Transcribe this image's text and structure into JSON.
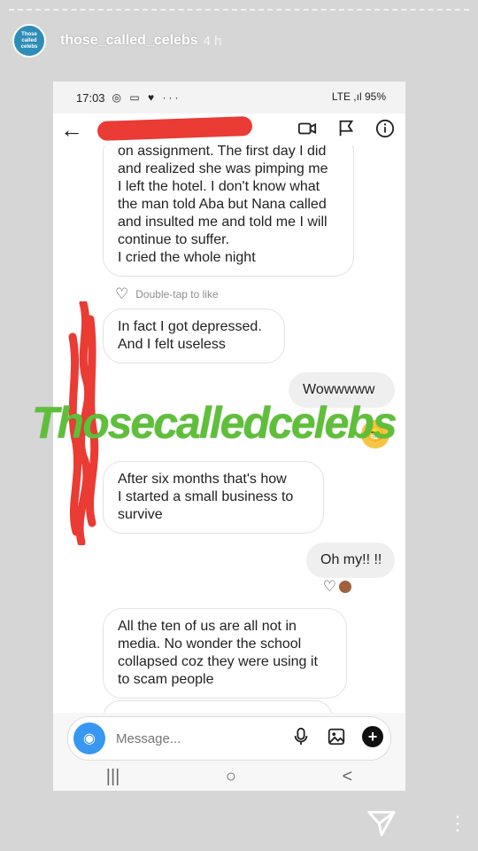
{
  "story": {
    "avatar_text": "Those called celebs",
    "username": "those_called_celebs",
    "time_ago": "4 h"
  },
  "status_bar": {
    "time": "17:03",
    "icons": "◎ ▭ ♥ ···",
    "right": "LTE ,ıl 95%"
  },
  "messages": {
    "m1": [
      "on assignment. The first day I did",
      "and realized she was pimping me",
      "I left the hotel. I don't know what",
      "the man told Aba but Nana called",
      "and insulted me and told me I will",
      "continue to suffer.",
      "I cried the whole night"
    ],
    "like_hint": "Double-tap to like",
    "m2": [
      "In fact I got depressed.",
      "And I felt useless"
    ],
    "m3": "Wowwwww",
    "m4": [
      "After six months that's how",
      "I started a small business to",
      "survive"
    ],
    "m5": "Oh my!! !!",
    "m6": [
      "All the ten of us are all not in",
      "media. No wonder the school",
      "collapsed coz they were using it",
      "to scam people"
    ]
  },
  "composer": {
    "placeholder": "Message..."
  },
  "android_nav": {
    "recents": "|||",
    "home": "○",
    "back": "<"
  },
  "watermark": "Thosecalledcelebs",
  "colors": {
    "watermark": "#5fbf3a",
    "redaction": "#ea3b34",
    "camera_button": "#3897f0"
  }
}
